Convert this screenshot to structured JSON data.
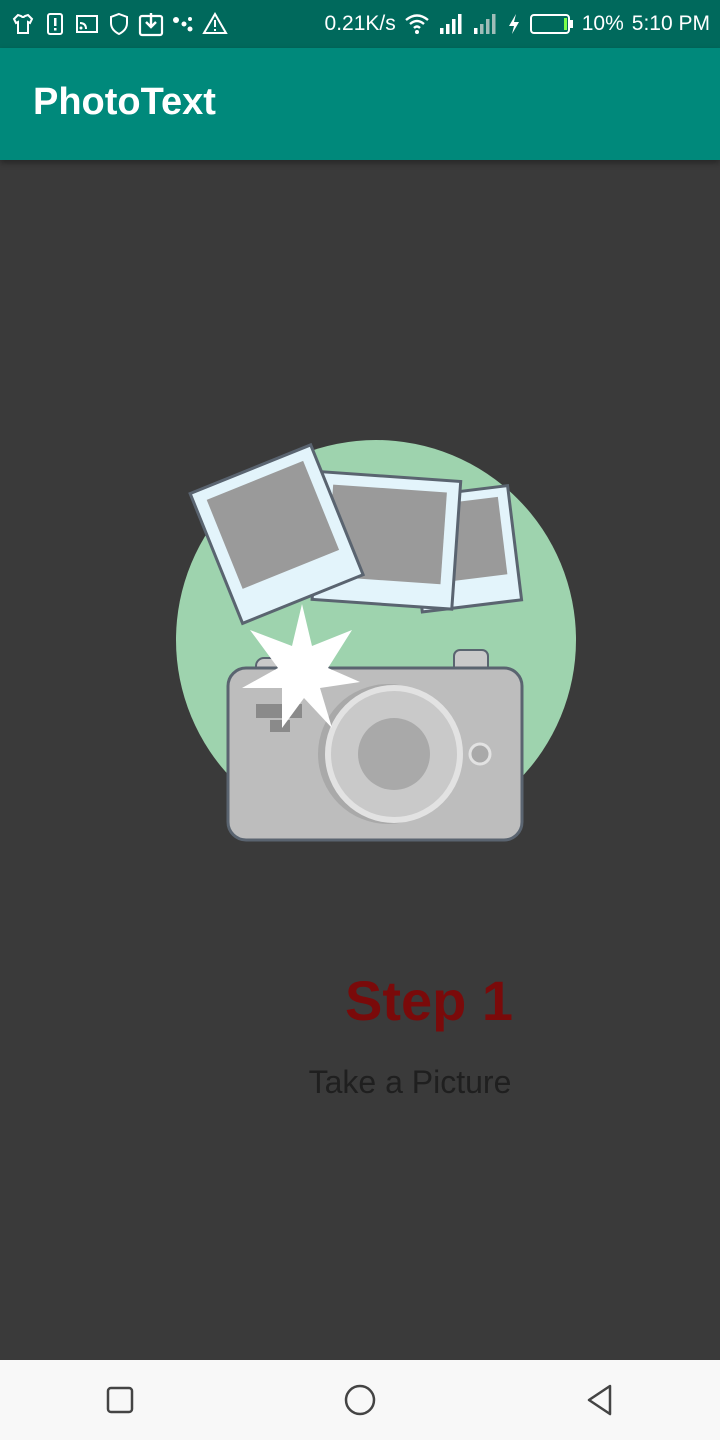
{
  "status_bar": {
    "network_speed": "0.21K/s",
    "battery_percent": "10%",
    "time": "5:10 PM",
    "icons": [
      "shirt-icon",
      "alert-card-icon",
      "cast-icon",
      "shield-icon",
      "download-icon",
      "dots-icon",
      "warning-icon",
      "wifi-icon",
      "signal-icon",
      "signal-weak-icon",
      "charging-icon",
      "battery-icon"
    ]
  },
  "app_bar": {
    "title": "PhotoText",
    "color": "#00897b"
  },
  "onboarding": {
    "step_title": "Step 1",
    "step_subtitle": "Take a Picture",
    "step_title_color": "#7a0a0a",
    "illustration": "camera-with-photos-illustration"
  },
  "nav_bar": {
    "buttons": [
      "recents-button",
      "home-button",
      "back-button"
    ]
  }
}
